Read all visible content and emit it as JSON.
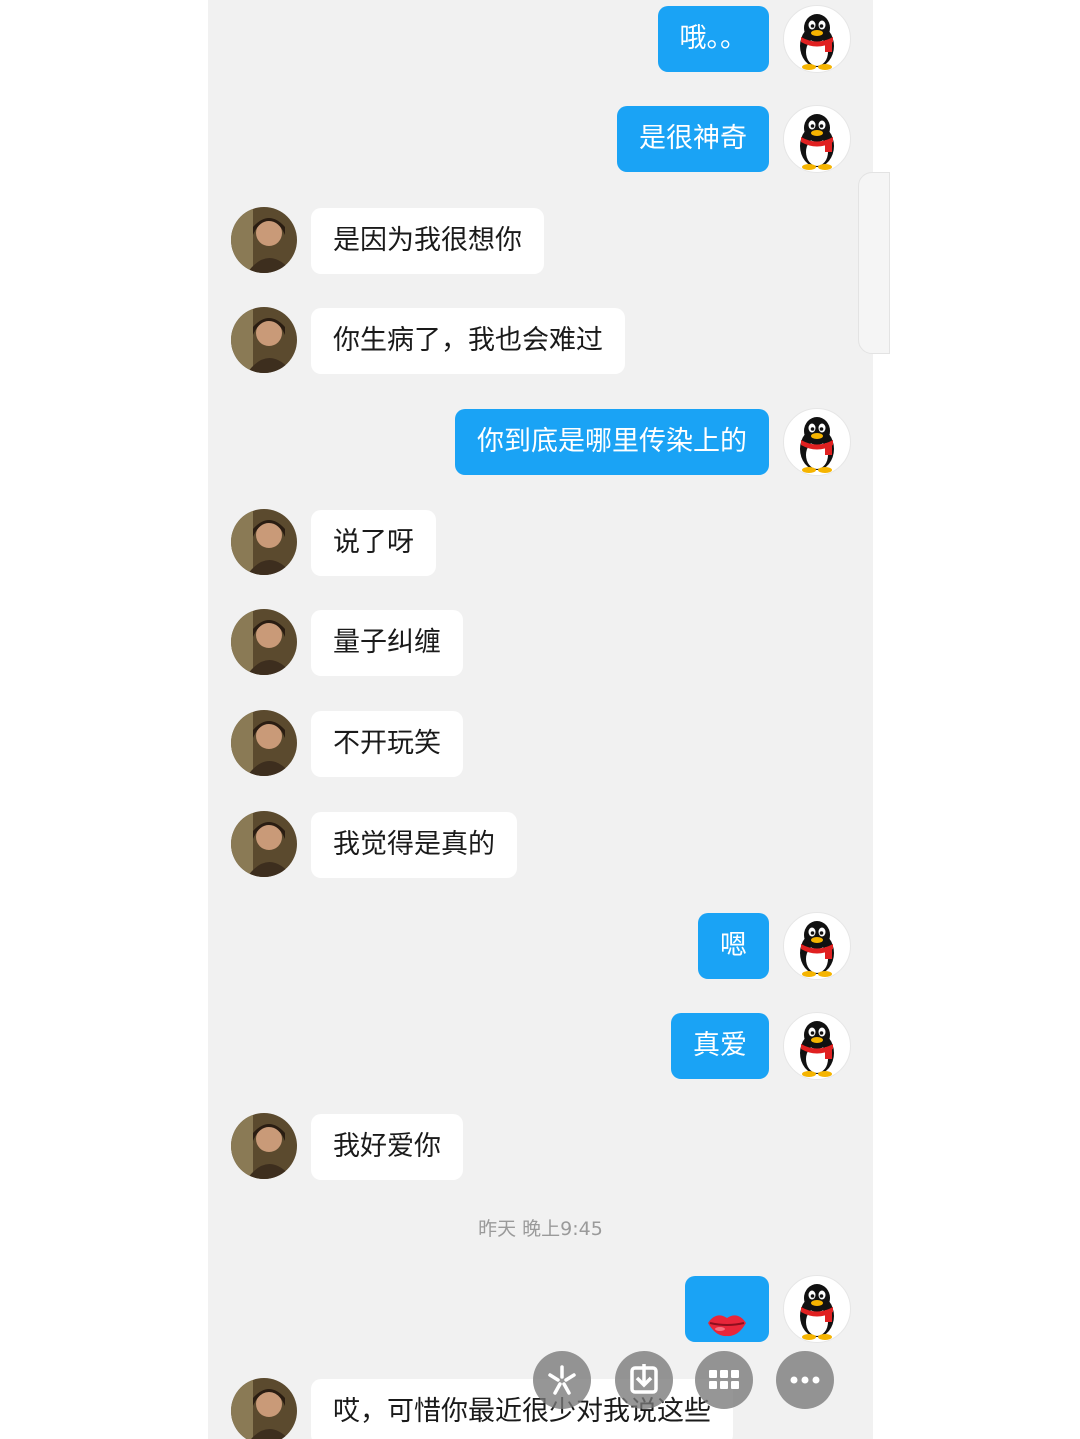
{
  "chat": {
    "messages": [
      {
        "side": "me",
        "text": "哦。。"
      },
      {
        "side": "me",
        "text": "是很神奇"
      },
      {
        "side": "peer",
        "text": "是因为我很想你"
      },
      {
        "side": "peer",
        "text": "你生病了，我也会难过"
      },
      {
        "side": "me",
        "text": "你到底是哪里传染上的"
      },
      {
        "side": "peer",
        "text": "说了呀"
      },
      {
        "side": "peer",
        "text": "量子纠缠"
      },
      {
        "side": "peer",
        "text": "不开玩笑"
      },
      {
        "side": "peer",
        "text": "我觉得是真的"
      },
      {
        "side": "me",
        "text": "嗯"
      },
      {
        "side": "me",
        "text": "真爱"
      },
      {
        "side": "peer",
        "text": "我好爱你"
      }
    ],
    "timestamp": "昨天 晚上9:45",
    "emoji_message": {
      "side": "me",
      "emoji": "lips-emoji"
    },
    "last_message": {
      "side": "peer",
      "text": "哎，可惜你最近很少对我说这些"
    }
  },
  "colors": {
    "my_bubble": "#1aa3f5",
    "peer_bubble": "#ffffff",
    "background": "#f1f1f1"
  },
  "floating_actions": [
    {
      "icon": "sparkle-icon"
    },
    {
      "icon": "download-icon"
    },
    {
      "icon": "grid-icon"
    },
    {
      "icon": "more-icon"
    }
  ]
}
